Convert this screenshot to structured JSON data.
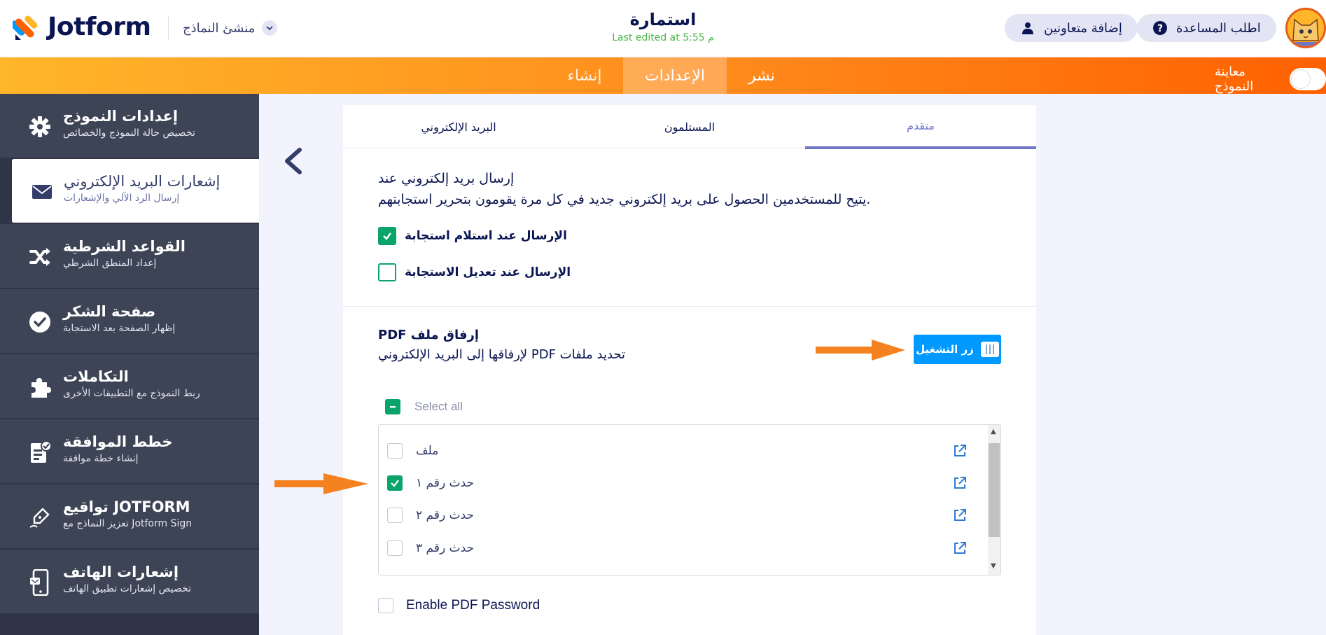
{
  "header": {
    "logo_text": "Jotform",
    "builder_label": "منشئ النماذج",
    "form_title": "استمارة",
    "last_edited": "Last edited at 5:55 م",
    "help_button": "اطلب المساعدة",
    "collaborators_button": "إضافة متعاونين"
  },
  "navbar": {
    "tabs": [
      {
        "label": "إنشاء"
      },
      {
        "label": "الإعدادات"
      },
      {
        "label": "نشر"
      }
    ],
    "preview_label": "معاينة النموذج"
  },
  "sidebar": {
    "items": [
      {
        "title": "إعدادات النموذج",
        "sub": "تخصيص حالة النموذج والخصائص"
      },
      {
        "title": "إشعارات البريد الإلكتروني",
        "sub": "إرسال الرد الآلي والإشعارات"
      },
      {
        "title": "القواعد الشرطية",
        "sub": "إعداد المنطق الشرطي"
      },
      {
        "title": "صفحة الشكر",
        "sub": "إظهار الصفحة بعد الاستجابة"
      },
      {
        "title": "التكاملات",
        "sub": "ربط النموذج مع التطبيقات الأخرى"
      },
      {
        "title": "خطط الموافقة",
        "sub": "إنشاء خطة موافقة"
      },
      {
        "title": "تواقيع JOTFORM",
        "sub": "تعزيز النماذج مع Jotform Sign"
      },
      {
        "title": "إشعارات الهاتف",
        "sub": "تخصيص إشعارات تطبيق الهاتف"
      }
    ]
  },
  "panel": {
    "tabs": [
      {
        "label": "البريد الإلكتروني"
      },
      {
        "label": "المستلمون"
      },
      {
        "label": "متقدم"
      }
    ],
    "send_section": {
      "title": "إرسال بريد إلكتروني عند",
      "desc": "يتيح للمستخدمين الحصول على بريد إلكتروني جديد في كل مرة يقومون بتحرير استجابتهم.",
      "opt_receive": "الإرسال عند استلام استجابة",
      "opt_edit": "الإرسال عند تعديل الاستجابة"
    },
    "pdf_section": {
      "title": "PDF إرفاق ملف",
      "desc": "لإرفاقها إلى البريد الإلكتروني PDF تحديد ملفات",
      "run_button": "زر التشغيل",
      "select_all": "Select all",
      "files": [
        {
          "label": "ملف",
          "checked": false
        },
        {
          "label": "حدث رقم ١",
          "checked": true
        },
        {
          "label": "حدث رقم ٢",
          "checked": false
        },
        {
          "label": "حدث رقم ٣",
          "checked": false
        }
      ],
      "password_label": "Enable PDF Password"
    }
  },
  "colors": {
    "orange_start": "#ffb629",
    "orange_end": "#ff6100",
    "sidebar_bg": "#3d4456",
    "accent_green": "#0aa46a",
    "run_blue": "#0099ff",
    "tab_active": "#6f76c6"
  }
}
